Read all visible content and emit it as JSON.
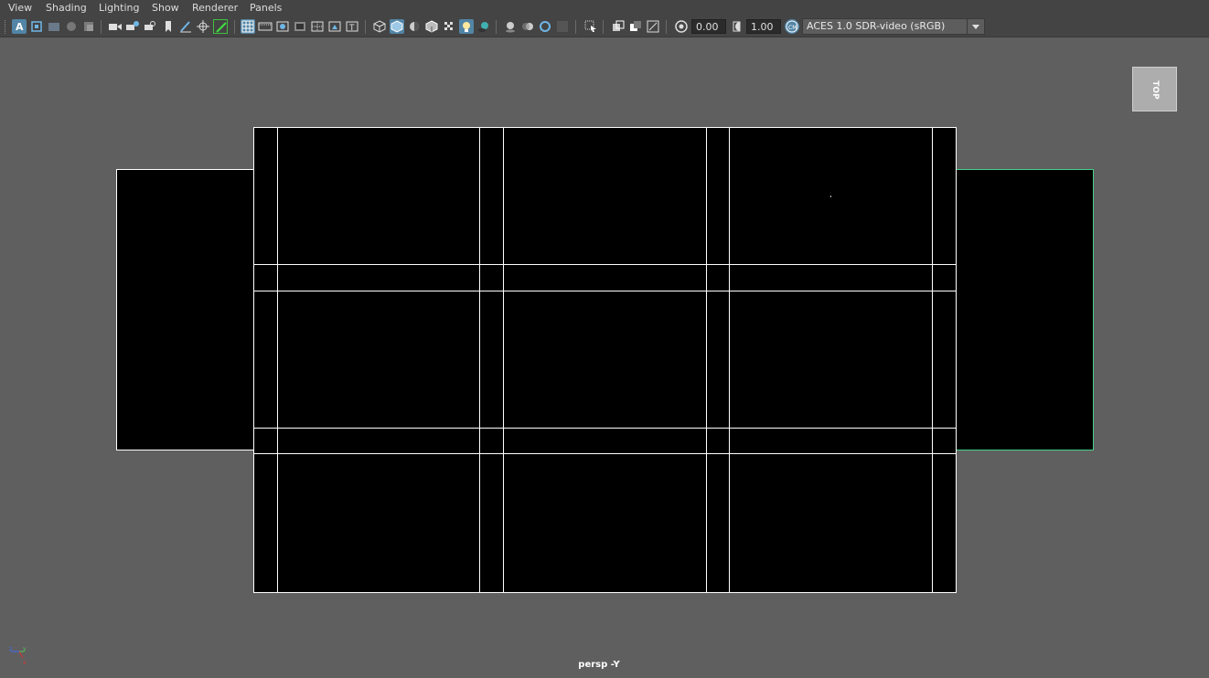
{
  "menu": {
    "items": [
      "View",
      "Shading",
      "Lighting",
      "Show",
      "Renderer",
      "Panels"
    ]
  },
  "toolbar": {
    "icons": [
      "select-camera-icon",
      "camera-attributes-icon",
      "bookmark-icon",
      "image-plane-icon",
      "grease-pencil-icon",
      "two-d-pan-zoom-icon",
      "grid-icon",
      "film-gate-icon",
      "resolution-gate-icon",
      "gate-mask-icon",
      "field-chart-icon",
      "safe-action-icon",
      "safe-title-icon",
      "wireframe-icon",
      "smooth-shade-icon",
      "use-default-material-icon",
      "wireframe-on-shaded-icon",
      "textured-icon",
      "use-all-lights-icon",
      "shadows-icon",
      "ambient-occlusion-icon",
      "motion-blur-icon",
      "anti-aliasing-icon",
      "depth-of-field-icon",
      "isolate-select-icon",
      "xray-icon",
      "xray-active-components-icon",
      "xray-joints-icon",
      "exposure-icon",
      "gamma-icon",
      "color-management-icon"
    ],
    "exposure_value": "0.00",
    "gamma_value": "1.00",
    "color_space": "ACES 1.0 SDR-video (sRGB)"
  },
  "viewport": {
    "view_cube_label": "TOP",
    "camera_name": "persp -Y",
    "axis": {
      "x": "x",
      "y": "y",
      "z": "z"
    },
    "colors": {
      "background": "#5f5f5f",
      "uv_shell_fill": "#000000",
      "uv_edge": "#ffffff",
      "selected_edge": "#44d18a",
      "active_icon": "#5285a6"
    }
  }
}
